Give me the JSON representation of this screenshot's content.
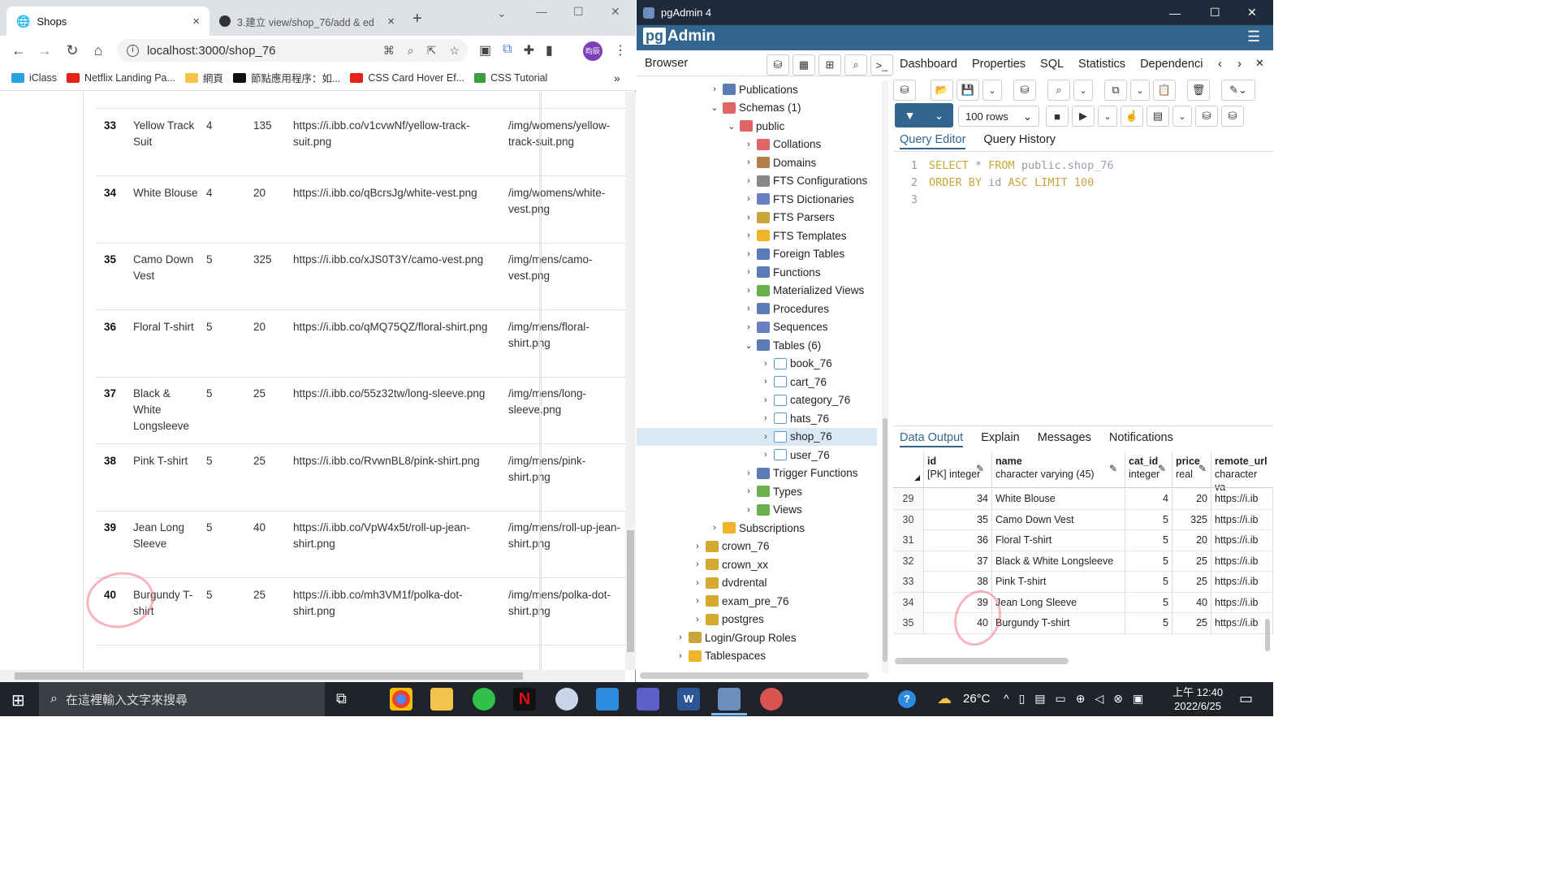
{
  "chrome": {
    "tabs": [
      {
        "title": "Shops",
        "close": "×"
      },
      {
        "title": "3.建立 view/shop_76/add & ed",
        "close": "×"
      }
    ],
    "new_tab": "+",
    "url": "localhost:3000/shop_76",
    "avatar_text": "昀辰",
    "bookmarks": [
      "iClass",
      "Netflix Landing Pa...",
      "網頁",
      "節點應用程序：如...",
      "CSS Card Hover Ef...",
      "CSS Tutorial"
    ],
    "bookmarks_more": "»",
    "window_controls": {
      "min": "—",
      "max": "☐",
      "close": "✕",
      "chevron": "⌄"
    }
  },
  "shop_rows": [
    {
      "id": "33",
      "name": "Yellow Track Suit",
      "cat": "4",
      "price": "135",
      "remote": "https://i.ibb.co/v1cvwNf/yellow-track-suit.png",
      "local": "/img/womens/yellow-track-suit.png"
    },
    {
      "id": "34",
      "name": "White Blouse",
      "cat": "4",
      "price": "20",
      "remote": "https://i.ibb.co/qBcrsJg/white-vest.png",
      "local": "/img/womens/white-vest.png"
    },
    {
      "id": "35",
      "name": "Camo Down Vest",
      "cat": "5",
      "price": "325",
      "remote": "https://i.ibb.co/xJS0T3Y/camo-vest.png",
      "local": "/img/mens/camo-vest.png"
    },
    {
      "id": "36",
      "name": "Floral T-shirt",
      "cat": "5",
      "price": "20",
      "remote": "https://i.ibb.co/qMQ75QZ/floral-shirt.png",
      "local": "/img/mens/floral-shirt.png"
    },
    {
      "id": "37",
      "name": "Black & White Longsleeve",
      "cat": "5",
      "price": "25",
      "remote": "https://i.ibb.co/55z32tw/long-sleeve.png",
      "local": "/img/mens/long-sleeve.png"
    },
    {
      "id": "38",
      "name": "Pink T-shirt",
      "cat": "5",
      "price": "25",
      "remote": "https://i.ibb.co/RvwnBL8/pink-shirt.png",
      "local": "/img/mens/pink-shirt.png"
    },
    {
      "id": "39",
      "name": "Jean Long Sleeve",
      "cat": "5",
      "price": "40",
      "remote": "https://i.ibb.co/VpW4x5t/roll-up-jean-shirt.png",
      "local": "/img/mens/roll-up-jean-shirt.png"
    },
    {
      "id": "40",
      "name": "Burgundy T-shirt",
      "cat": "5",
      "price": "25",
      "remote": "https://i.ibb.co/mh3VM1f/polka-dot-shirt.png",
      "local": "/img/mens/polka-dot-shirt.png"
    }
  ],
  "pgadmin": {
    "title": "pgAdmin 4",
    "brand_prefix": "pg",
    "brand_suffix": "Admin",
    "browser_label": "Browser",
    "main_tabs": [
      "Dashboard",
      "Properties",
      "SQL",
      "Statistics",
      "Dependenci"
    ],
    "tree": [
      {
        "level": 4,
        "label": "Publications",
        "chev": "›"
      },
      {
        "level": 4,
        "label": "Schemas (1)",
        "chev": "⌄"
      },
      {
        "level": 5,
        "label": "public",
        "chev": "⌄"
      },
      {
        "level": 6,
        "label": "Collations",
        "chev": "›"
      },
      {
        "level": 6,
        "label": "Domains",
        "chev": "›"
      },
      {
        "level": 6,
        "label": "FTS Configurations",
        "chev": "›"
      },
      {
        "level": 6,
        "label": "FTS Dictionaries",
        "chev": "›"
      },
      {
        "level": 6,
        "label": "FTS Parsers",
        "chev": "›"
      },
      {
        "level": 6,
        "label": "FTS Templates",
        "chev": "›"
      },
      {
        "level": 6,
        "label": "Foreign Tables",
        "chev": "›"
      },
      {
        "level": 6,
        "label": "Functions",
        "chev": "›"
      },
      {
        "level": 6,
        "label": "Materialized Views",
        "chev": "›"
      },
      {
        "level": 6,
        "label": "Procedures",
        "chev": "›"
      },
      {
        "level": 6,
        "label": "Sequences",
        "chev": "›"
      },
      {
        "level": 6,
        "label": "Tables (6)",
        "chev": "⌄"
      },
      {
        "level": 7,
        "label": "book_76",
        "chev": "›"
      },
      {
        "level": 7,
        "label": "cart_76",
        "chev": "›"
      },
      {
        "level": 7,
        "label": "category_76",
        "chev": "›"
      },
      {
        "level": 7,
        "label": "hats_76",
        "chev": "›"
      },
      {
        "level": 7,
        "label": "shop_76",
        "chev": "›",
        "selected": true
      },
      {
        "level": 7,
        "label": "user_76",
        "chev": "›"
      },
      {
        "level": 6,
        "label": "Trigger Functions",
        "chev": "›"
      },
      {
        "level": 6,
        "label": "Types",
        "chev": "›"
      },
      {
        "level": 6,
        "label": "Views",
        "chev": "›"
      },
      {
        "level": 4,
        "label": "Subscriptions",
        "chev": "›"
      },
      {
        "level": 3,
        "label": "crown_76",
        "chev": "›"
      },
      {
        "level": 3,
        "label": "crown_xx",
        "chev": "›"
      },
      {
        "level": 3,
        "label": "dvdrental",
        "chev": "›"
      },
      {
        "level": 3,
        "label": "exam_pre_76",
        "chev": "›"
      },
      {
        "level": 3,
        "label": "postgres",
        "chev": "›"
      },
      {
        "level": 2,
        "label": "Login/Group Roles",
        "chev": "›"
      },
      {
        "level": 2,
        "label": "Tablespaces",
        "chev": "›"
      }
    ],
    "rows_select": "100 rows",
    "query_tabs": [
      "Query Editor",
      "Query History"
    ],
    "sql_lines": [
      {
        "n": "1",
        "parts": [
          [
            "kw",
            "SELECT"
          ],
          [
            "tx",
            " * "
          ],
          [
            "kw",
            "FROM"
          ],
          [
            "tx",
            " public."
          ],
          [
            "id2",
            "shop_76"
          ]
        ]
      },
      {
        "n": "2",
        "parts": [
          [
            "kw",
            "ORDER BY"
          ],
          [
            "tx",
            " id "
          ],
          [
            "kw",
            "ASC"
          ],
          [
            "tx",
            " "
          ],
          [
            "kw",
            "LIMIT"
          ],
          [
            "tx",
            " "
          ],
          [
            "num",
            "100"
          ]
        ]
      },
      {
        "n": "3",
        "parts": []
      }
    ],
    "output_tabs": [
      "Data Output",
      "Explain",
      "Messages",
      "Notifications"
    ],
    "grid_headers": [
      {
        "name": "id",
        "type": "[PK] integer"
      },
      {
        "name": "name",
        "type": "character varying (45)"
      },
      {
        "name": "cat_id",
        "type": "integer"
      },
      {
        "name": "price",
        "type": "real"
      },
      {
        "name": "remote_url",
        "type": "character va"
      }
    ],
    "grid_rows": [
      {
        "row": "29",
        "id": "34",
        "name": "White Blouse",
        "cat": "4",
        "price": "20",
        "url": "https://i.ib"
      },
      {
        "row": "30",
        "id": "35",
        "name": "Camo Down Vest",
        "cat": "5",
        "price": "325",
        "url": "https://i.ib"
      },
      {
        "row": "31",
        "id": "36",
        "name": "Floral T-shirt",
        "cat": "5",
        "price": "20",
        "url": "https://i.ib"
      },
      {
        "row": "32",
        "id": "37",
        "name": "Black & White Longsleeve",
        "cat": "5",
        "price": "25",
        "url": "https://i.ib"
      },
      {
        "row": "33",
        "id": "38",
        "name": "Pink T-shirt",
        "cat": "5",
        "price": "25",
        "url": "https://i.ib"
      },
      {
        "row": "34",
        "id": "39",
        "name": "Jean Long Sleeve",
        "cat": "5",
        "price": "40",
        "url": "https://i.ib"
      },
      {
        "row": "35",
        "id": "40",
        "name": "Burgundy T-shirt",
        "cat": "5",
        "price": "25",
        "url": "https://i.ib"
      }
    ]
  },
  "taskbar": {
    "search_placeholder": "在這裡輸入文字來搜尋",
    "temperature": "26°C",
    "time": "上午 12:40",
    "date": "2022/6/25"
  }
}
